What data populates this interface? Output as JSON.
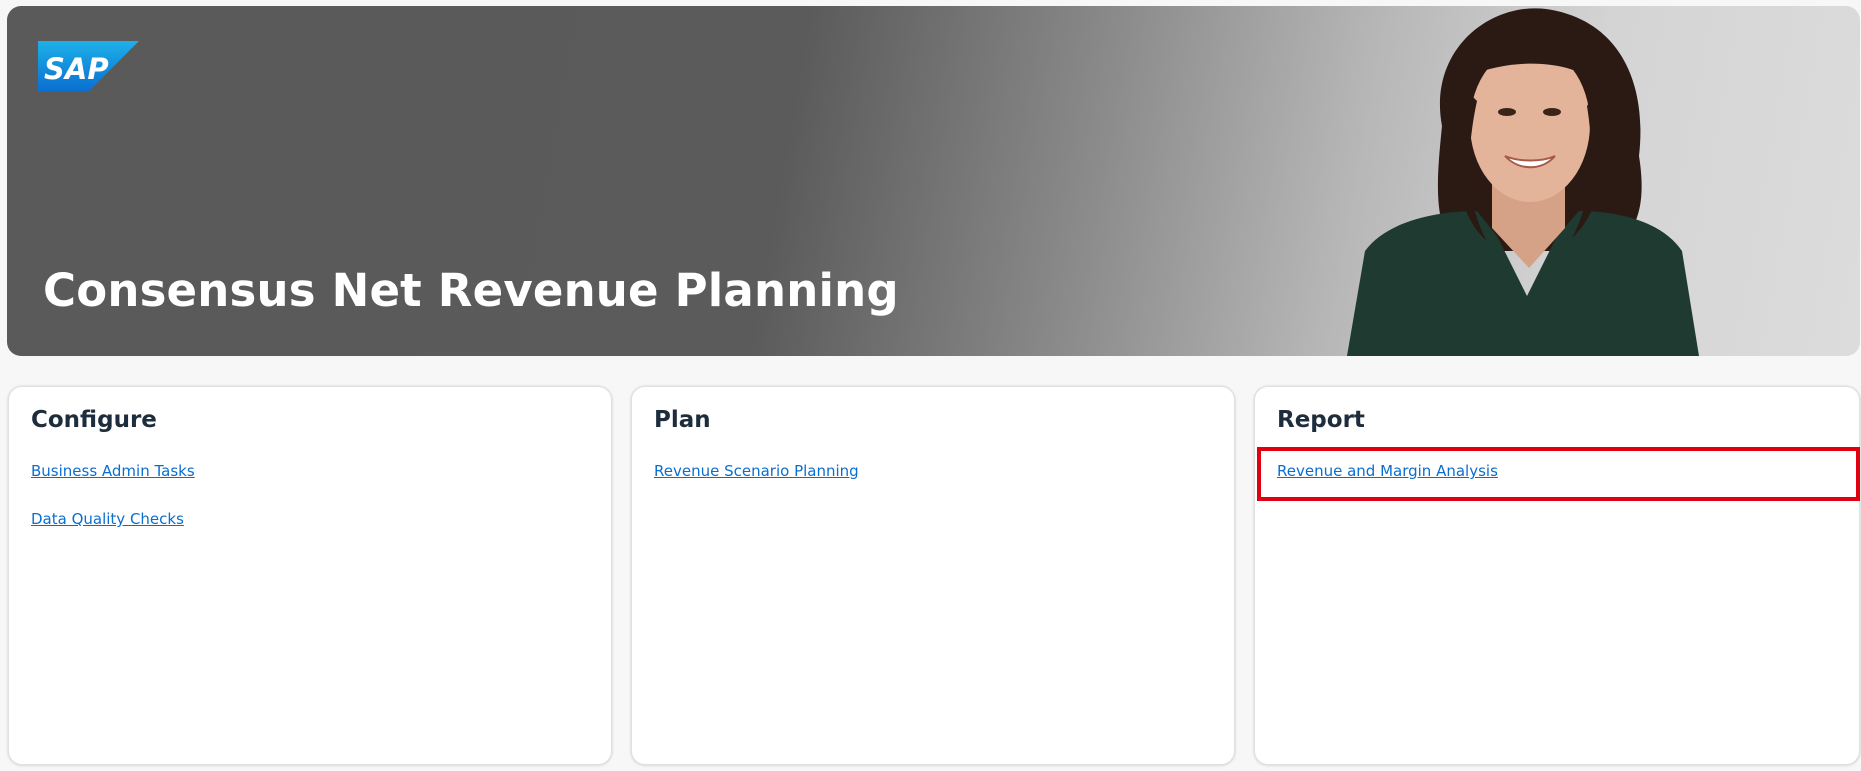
{
  "banner": {
    "title": "Consensus Net Revenue Planning",
    "logo_text": "SAP",
    "colors": {
      "logo_blue_top": "#1eb0e8",
      "logo_blue_bottom": "#0a6ed1",
      "title_text": "#ffffff"
    }
  },
  "cards": [
    {
      "title": "Configure",
      "links": [
        "Business Admin Tasks",
        "Data Quality Checks"
      ]
    },
    {
      "title": "Plan",
      "links": [
        "Revenue Scenario Planning"
      ]
    },
    {
      "title": "Report",
      "links": [
        "Revenue and Margin Analysis"
      ]
    }
  ],
  "colors": {
    "link": "#0a6ed1",
    "card_title": "#1d2d3e",
    "highlight": "#e1000f"
  }
}
